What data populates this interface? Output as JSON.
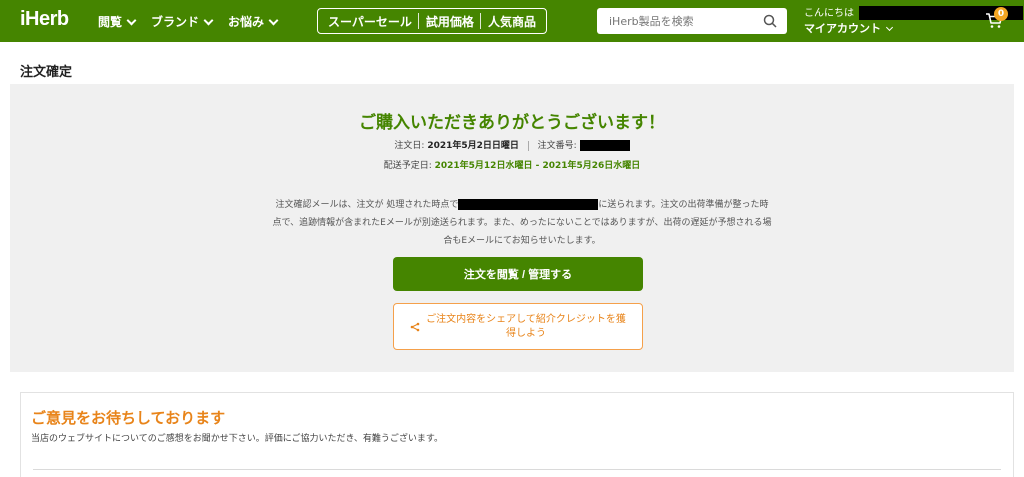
{
  "header": {
    "logo": "iHerb",
    "nav": [
      {
        "label": "閲覧"
      },
      {
        "label": "ブランド"
      },
      {
        "label": "お悩み"
      }
    ],
    "promo": [
      "スーパーセール",
      "試用価格",
      "人気商品"
    ],
    "search_placeholder": "iHerb製品を検索",
    "greeting": "こんにちは",
    "my_account": "マイアカウント",
    "cart_count": "0",
    "colors": {
      "brand": "#458500",
      "accent": "#f5a623"
    }
  },
  "page": {
    "title": "注文確定"
  },
  "confirmation": {
    "thanks": "ご購入いただきありがとうございます！",
    "order_date_label": "注文日:",
    "order_date": "2021年5月2日日曜日",
    "order_number_label": "注文番号:",
    "delivery_label": "配送予定日:",
    "delivery_range": "2021年5月12日水曜日 - 2021年5月26日水曜日",
    "desc_part1": "注文確認メールは、注文が 処理された時点で",
    "desc_part2": "に送られます。注文の出荷準備が整った時点で、追跡情報が含まれたEメールが別途送られます。また、めったにないことではありますが、出荷の遅延が予想される場合もEメールにてお知らせいたします。",
    "view_button": "注文を閲覧 / 管理する",
    "share_button": "ご注文内容をシェアして紹介クレジットを獲得しよう"
  },
  "feedback": {
    "title": "ご意見をお待ちしております",
    "subtitle": "当店のウェブサイトについてのご感想をお聞かせ下さい。評価にご協力いただき、有難うございます。"
  }
}
